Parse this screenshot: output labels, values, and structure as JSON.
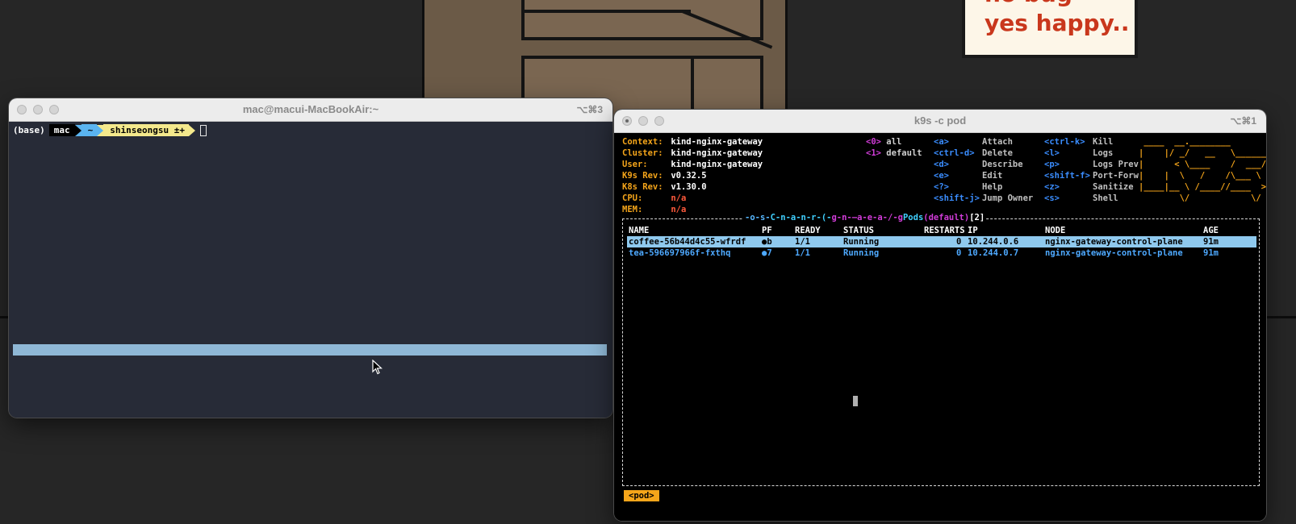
{
  "background": {
    "note": {
      "line1": "no bug",
      "line2": "yes happy.."
    }
  },
  "terminal1": {
    "title": "mac@macui-MacBookAir:~",
    "shortcut": "⌥⌘3",
    "prompt": {
      "env": "(base)",
      "user": "mac",
      "dir": "~",
      "git": " shinseongsu ±+"
    }
  },
  "terminal2": {
    "title": "k9s -c pod",
    "shortcut": "⌥⌘1",
    "info": [
      {
        "key": "Context:",
        "value": "kind-nginx-gateway"
      },
      {
        "key": "Cluster:",
        "value": "kind-nginx-gateway"
      },
      {
        "key": "User:",
        "value": "kind-nginx-gateway"
      },
      {
        "key": "K9s Rev:",
        "value": "v0.32.5"
      },
      {
        "key": "K8s Rev:",
        "value": "v1.30.0"
      },
      {
        "key": "CPU:",
        "value": "n/a"
      },
      {
        "key": "MEM:",
        "value": "n/a"
      }
    ],
    "namespaces": [
      {
        "key": "<0>",
        "label": "all"
      },
      {
        "key": "<1>",
        "label": "default"
      }
    ],
    "hotkeys_col1": [
      {
        "key": "<a>",
        "label": "Attach"
      },
      {
        "key": "<ctrl-d>",
        "label": "Delete"
      },
      {
        "key": "<d>",
        "label": "Describe"
      },
      {
        "key": "<e>",
        "label": "Edit"
      },
      {
        "key": "<?>",
        "label": "Help"
      },
      {
        "key": "<shift-j>",
        "label": "Jump Owner"
      }
    ],
    "hotkeys_col2": [
      {
        "key": "<ctrl-k>",
        "label": "Kill"
      },
      {
        "key": "<l>",
        "label": "Logs"
      },
      {
        "key": "<p>",
        "label": "Logs Prev"
      },
      {
        "key": "<shift-f>",
        "label": "Port-Forw"
      },
      {
        "key": "<z>",
        "label": "Sanitize"
      },
      {
        "key": "<s>",
        "label": "Shell"
      }
    ],
    "frame_title": {
      "prefix": "-o-s-",
      "mid": "C-n-a-n-r-(-",
      "ns": "g-n-–a-e-a-/-g",
      "resource": "Pods",
      "scope": "(default)",
      "count": "[2]"
    },
    "table": {
      "headers": [
        "NAME",
        "PF",
        "READY",
        "STATUS",
        "RESTARTS",
        "IP",
        "NODE",
        "AGE"
      ],
      "rows": [
        {
          "name": "coffee-56b44d4c55-wfrdf",
          "pf": "●b",
          "ready": "1/1",
          "status": "Running",
          "restarts": "0",
          "ip": "10.244.0.6",
          "node": "nginx-gateway-control-plane",
          "age": "91m"
        },
        {
          "name": "tea-596697966f-fxthq",
          "pf": "●7",
          "ready": "1/1",
          "status": "Running",
          "restarts": "0",
          "ip": "10.244.0.7",
          "node": "nginx-gateway-control-plane",
          "age": "91m"
        }
      ]
    },
    "breadcrumb": "<pod>"
  },
  "colors": {
    "k9s_key": "#f5a51a",
    "k9s_hotkey": "#3a8dff",
    "k9s_namespace": "#d13cd8",
    "selected_row": "#8fc9ee",
    "row_text": "#4ea9ff",
    "prompt_dir": "#5ab4f0",
    "prompt_git": "#f4e98c"
  }
}
